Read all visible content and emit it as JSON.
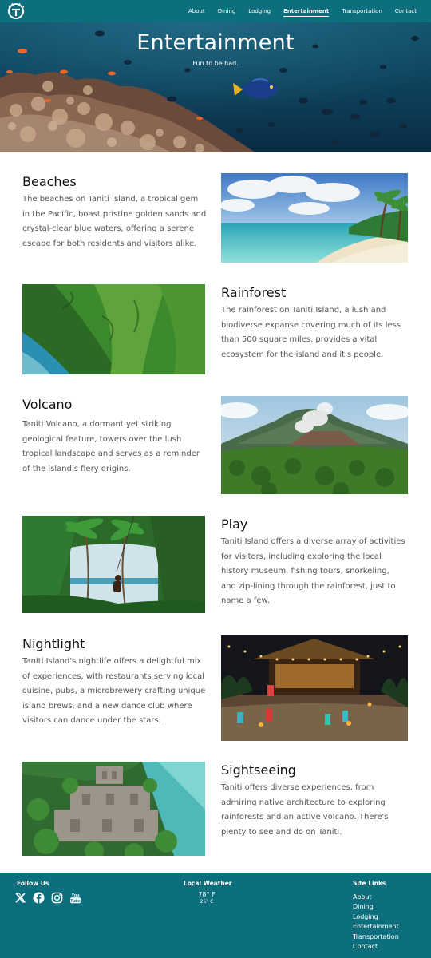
{
  "nav": {
    "links": [
      {
        "label": "About"
      },
      {
        "label": "Dining"
      },
      {
        "label": "Lodging"
      },
      {
        "label": "Entertainment",
        "active": true
      },
      {
        "label": "Transportation"
      },
      {
        "label": "Contact"
      }
    ]
  },
  "hero": {
    "title": "Entertainment",
    "subtitle": "Fun to be had."
  },
  "sections": [
    {
      "title": "Beaches",
      "body": "The beaches on Taniti Island, a tropical gem in the Pacific, boast pristine golden sands and crystal-clear blue waters, offering a serene escape for both residents and visitors alike."
    },
    {
      "title": "Rainforest",
      "body": "The rainforest on Taniti Island, a lush and biodiverse expanse covering much of its less than 500 square miles, provides a vital ecosystem for the island and it's people."
    },
    {
      "title": "Volcano",
      "body": "Taniti Volcano, a dormant yet striking geological feature, towers over the lush tropical landscape and serves as a reminder of the island's fiery origins."
    },
    {
      "title": "Play",
      "body": "Taniti Island offers a diverse array of activities for visitors, including exploring the local history museum, fishing tours, snorkeling, and zip-lining through the rainforest, just to name a few."
    },
    {
      "title": "Nightlight",
      "body": "Taniti Island's nightlife offers a delightful mix of experiences, with restaurants serving local cuisine, pubs, a microbrewery crafting unique island brews, and a new dance club where visitors can dance under the stars."
    },
    {
      "title": "Sightseeing",
      "body": "Taniti offers diverse experiences, from admiring native architecture to exploring rainforests and an active volcano. There's plenty to see and do on Taniti."
    }
  ],
  "footer": {
    "follow_heading": "Follow Us",
    "social_icons": [
      "x-icon",
      "facebook-icon",
      "instagram-icon",
      "youtube-icon"
    ],
    "youtube_label": "You Tube",
    "weather_heading": "Local Weather",
    "temp_f": "78° F",
    "temp_c": "25° C",
    "links_heading": "Site Links",
    "links": [
      "About",
      "Dining",
      "Lodging",
      "Entertainment",
      "Transportation",
      "Contact"
    ]
  },
  "colors": {
    "brand_teal": "#0d6f7d",
    "text_dark": "#111111",
    "text_body": "#555555"
  }
}
